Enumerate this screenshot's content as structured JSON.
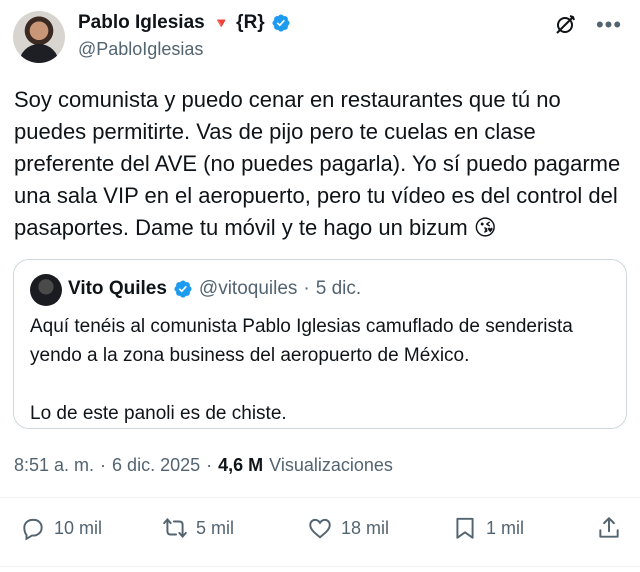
{
  "author": {
    "name": "Pablo Iglesias",
    "emoji": "🔻",
    "tag": "{R}",
    "handle": "@PabloIglesias"
  },
  "tweet": {
    "text": "Soy comunista y puedo cenar en restaurantes que tú no\npuedes permitirte. Vas de pijo pero te cuelas en clase\npreferente del AVE (no puedes pagarla). Yo sí puedo pagarme\nuna sala VIP en el aeropuerto, pero tu vídeo es del control del\npasaportes. Dame tu móvil y te hago un bizum ",
    "emoji": "😘"
  },
  "quote": {
    "name": "Vito Quiles",
    "handle": "@vitoquiles",
    "dot": "·",
    "date": "5 dic.",
    "paragraph1": "Aquí tenéis al comunista Pablo Iglesias camuflado de senderista yendo a la zona business del aeropuerto de México.",
    "paragraph2": "Lo de este panoli es de chiste."
  },
  "meta": {
    "time": "8:51 a. m.",
    "dot1": "·",
    "date": "6 dic. 2025",
    "dot2": "·",
    "views_count": "4,6 M",
    "views_label": "Visualizaciones"
  },
  "actions": {
    "replies": "10 mil",
    "reposts": "5 mil",
    "likes": "18 mil",
    "bookmarks": "1 mil"
  },
  "icons": {
    "verified": "verified-badge-icon",
    "grok": "grok-icon",
    "more": "more-icon",
    "reply": "reply-icon",
    "repost": "repost-icon",
    "like": "like-icon",
    "bookmark": "bookmark-icon",
    "share": "share-icon"
  },
  "colors": {
    "verified": "#1d9bf0",
    "muted": "#536471",
    "text": "#0f1419",
    "border": "#cfd9de"
  }
}
